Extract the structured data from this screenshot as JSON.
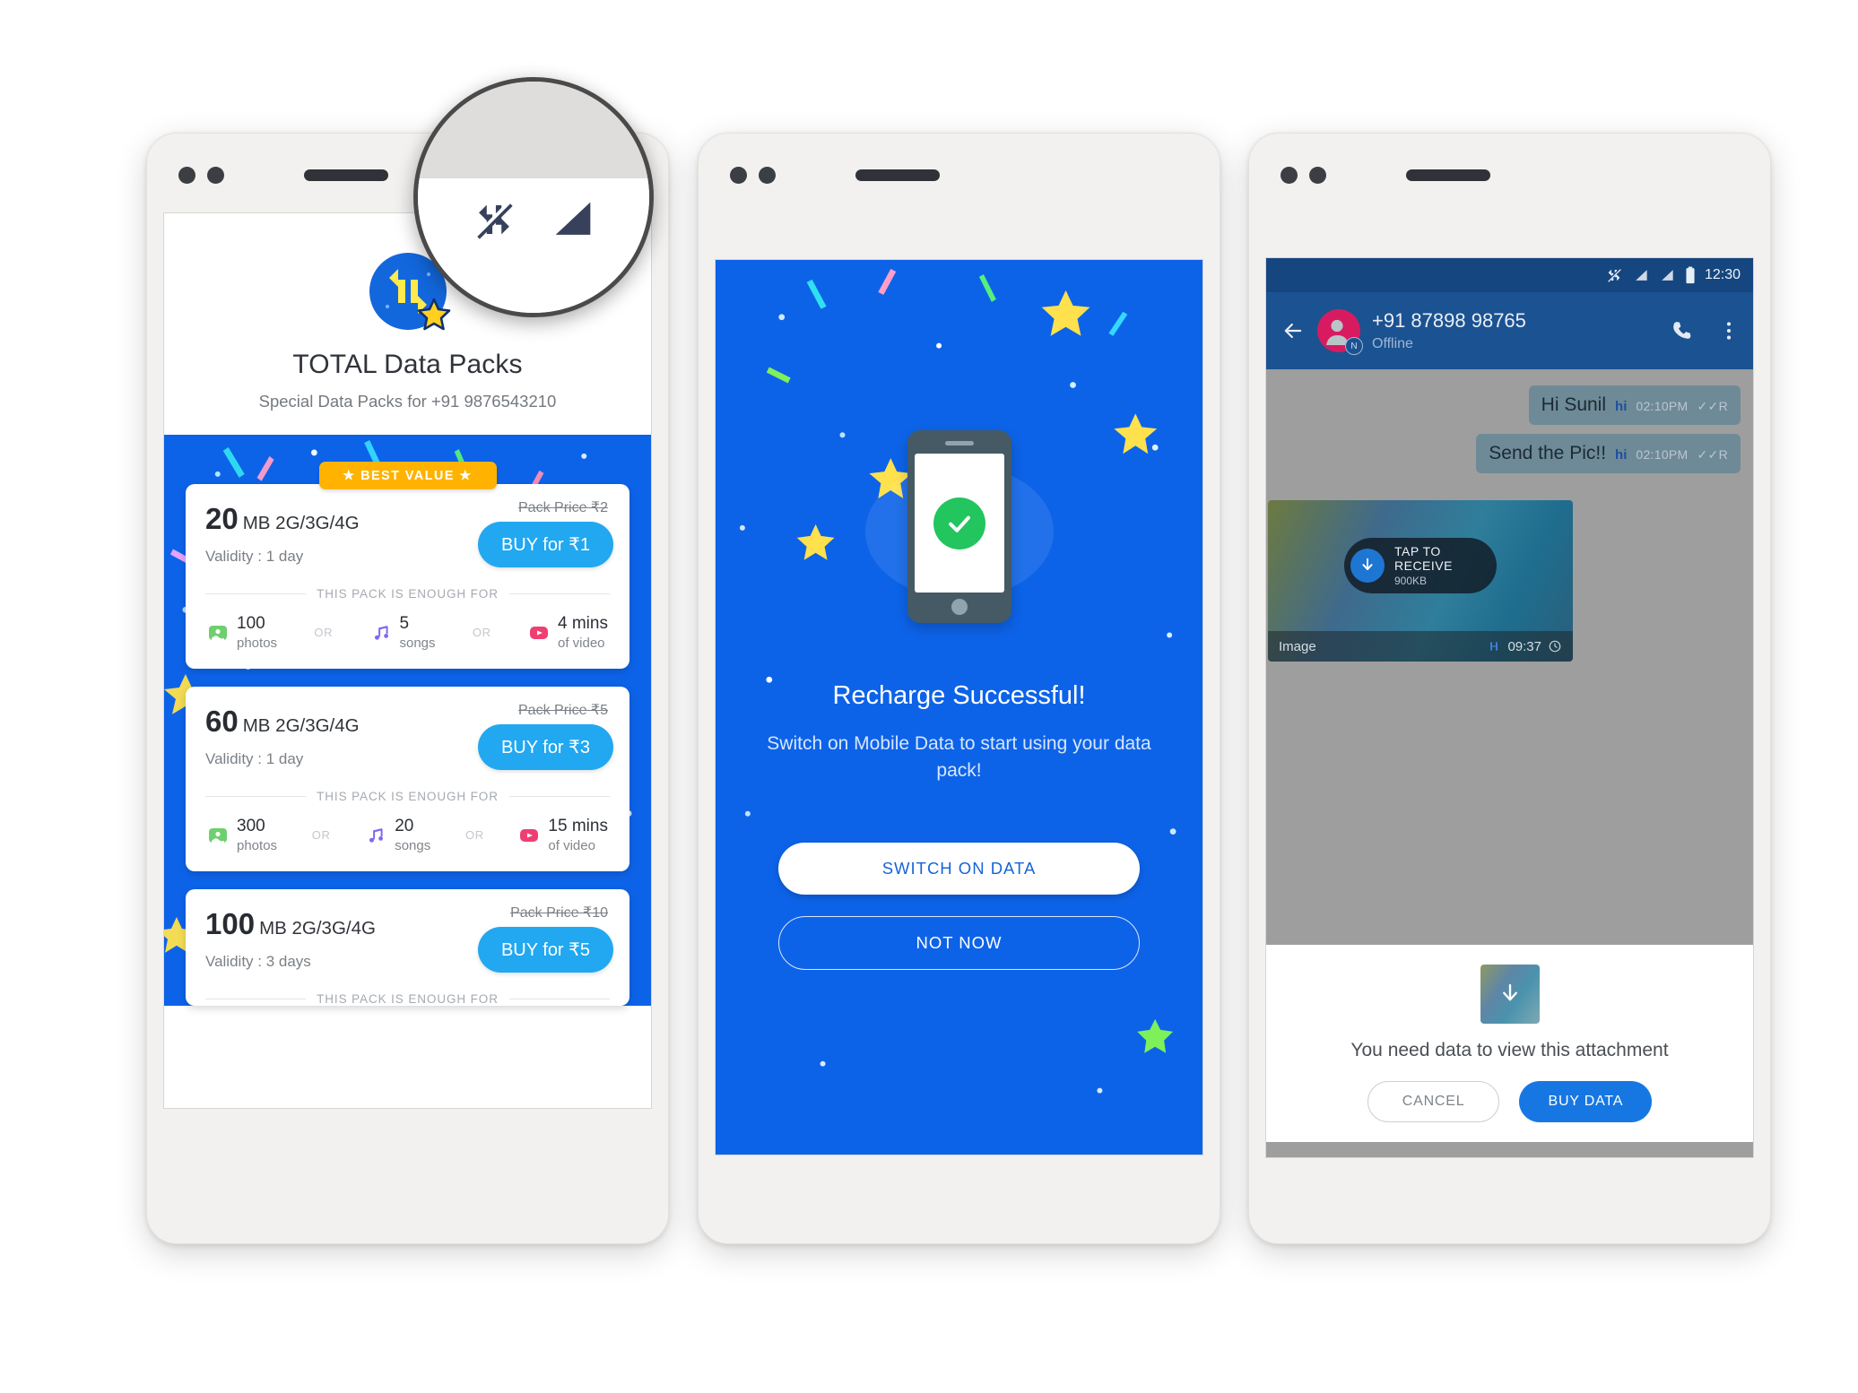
{
  "packs_screen": {
    "logo_icon": "data-arrows-star-icon",
    "title": "TOTAL Data Packs",
    "subtitle": "Special Data Packs for +91 9876543210",
    "best_value_label": "★ BEST VALUE ★",
    "enough_for_label": "THIS PACK IS ENOUGH FOR",
    "or_label": "OR",
    "packs": [
      {
        "amount": "20",
        "unit": "MB 2G/3G/4G",
        "validity": "Validity : 1 day",
        "old_price": "Pack Price ₹2",
        "buy_label": "BUY for ₹1",
        "usage": [
          {
            "icon": "photo-icon",
            "count": "100",
            "unit": "photos"
          },
          {
            "icon": "music-note-icon",
            "count": "5",
            "unit": "songs"
          },
          {
            "icon": "video-play-icon",
            "count": "4 mins",
            "unit": "of video"
          }
        ]
      },
      {
        "amount": "60",
        "unit": "MB 2G/3G/4G",
        "validity": "Validity : 1 day",
        "old_price": "Pack Price ₹5",
        "buy_label": "BUY for ₹3",
        "usage": [
          {
            "icon": "photo-icon",
            "count": "300",
            "unit": "photos"
          },
          {
            "icon": "music-note-icon",
            "count": "20",
            "unit": "songs"
          },
          {
            "icon": "video-play-icon",
            "count": "15 mins",
            "unit": "of video"
          }
        ]
      },
      {
        "amount": "100",
        "unit": "MB 2G/3G/4G",
        "validity": "Validity : 3 days",
        "old_price": "Pack Price ₹10",
        "buy_label": "BUY for ₹5",
        "usage": []
      }
    ]
  },
  "magnifier": {
    "icons": [
      "mobile-data-off-icon",
      "signal-bars-icon"
    ]
  },
  "success_screen": {
    "title": "Recharge Successful!",
    "subtitle": "Switch on Mobile Data to start using your data pack!",
    "primary_button": "SWITCH ON DATA",
    "secondary_button": "NOT NOW",
    "hero_icon": "phone-with-checkmark-icon"
  },
  "chat_screen": {
    "status_bar": {
      "time": "12:30",
      "icons": [
        "mobile-data-off-icon",
        "signal-bars-icon",
        "signal-bars-icon",
        "battery-icon"
      ]
    },
    "app_bar": {
      "back_icon": "back-arrow-icon",
      "avatar_icon": "contact-avatar-icon",
      "contact_number": "+91 87898 98765",
      "presence": "Offline",
      "call_icon": "phone-call-icon",
      "overflow_icon": "more-vertical-icon"
    },
    "messages": [
      {
        "text": "Hi Sunil",
        "app": "hi",
        "time": "02:10PM",
        "receipt": "✓✓R"
      },
      {
        "text": "Send the Pic!!",
        "app": "hi",
        "time": "02:10PM",
        "receipt": "✓✓R"
      }
    ],
    "attachment": {
      "tap_label": "TAP TO RECEIVE",
      "size": "900KB",
      "type_label": "Image",
      "time": "09:37",
      "download_icon": "download-arrow-icon",
      "clock_icon": "clock-icon"
    },
    "sheet": {
      "thumb_icon": "download-arrow-icon",
      "message": "You need data to view this attachment",
      "cancel_label": "CANCEL",
      "buy_label": "BUY DATA"
    }
  },
  "colors": {
    "brand_blue": "#0d63e8",
    "buy_blue": "#21a8f0",
    "gold": "#ffb300",
    "chat_header": "#1b5291",
    "success_green": "#22c55e"
  }
}
